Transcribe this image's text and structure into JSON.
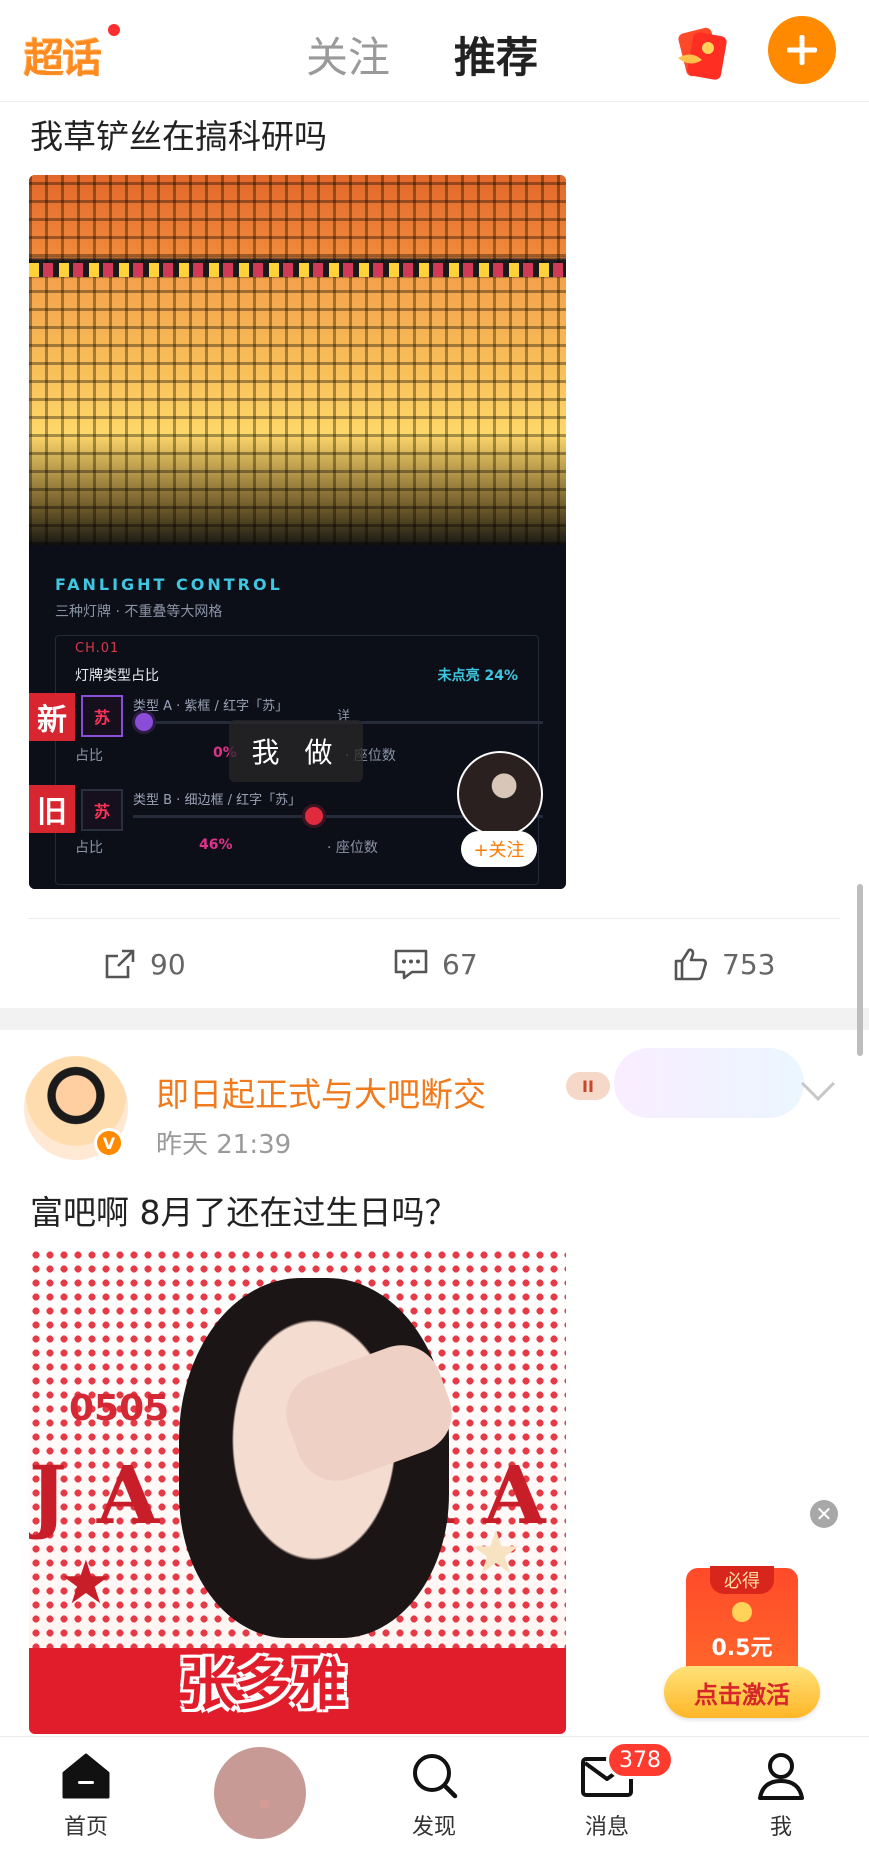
{
  "topbar": {
    "logo_text": "超话",
    "tabs": [
      {
        "label": "关注",
        "active": false
      },
      {
        "label": "推荐",
        "active": true
      }
    ],
    "accent_color": "#ff8a00"
  },
  "post1": {
    "text": "我草铲丝在搞科研吗",
    "image": {
      "panel_title": "FANLIGHT CONTROL",
      "panel_subtitle": "三种灯牌 · 不重叠等大网格",
      "channel": "CH.01",
      "mix_label": "灯牌类型占比",
      "unlit_label": "未点亮 24%",
      "badge_new": "新",
      "badge_old": "旧",
      "su_char": "苏",
      "type_a": "类型 A · 紫框 / 红字「苏」",
      "type_b": "类型 B · 细边框 / 红字「苏」",
      "ratio_label": "占比",
      "pct_a": "0%",
      "pct_b": "46%",
      "seats_label": "· 座位数",
      "detail_label": "详",
      "overlay_text": "我 做",
      "follow_label": "+关注"
    },
    "actions": {
      "share_count": "90",
      "comment_count": "67",
      "like_count": "753"
    }
  },
  "post2": {
    "username": "即日起正式与大吧断交",
    "level": "II",
    "verified_badge": "V",
    "time": "昨天  21:39",
    "text": "富吧啊 8月了还在过生日吗？",
    "image": {
      "date_text": "0505",
      "big_text": "JANDAA",
      "name_text": "张多雅"
    }
  },
  "floating_ad": {
    "top_label": "必得",
    "amount": "0.5元",
    "button_label": "点击激活",
    "close_symbol": "✕"
  },
  "bottom_nav": {
    "items": [
      {
        "label": "首页"
      },
      {
        "label": "发现"
      },
      {
        "label": "消息"
      },
      {
        "label": "我"
      }
    ],
    "message_badge": "378"
  }
}
